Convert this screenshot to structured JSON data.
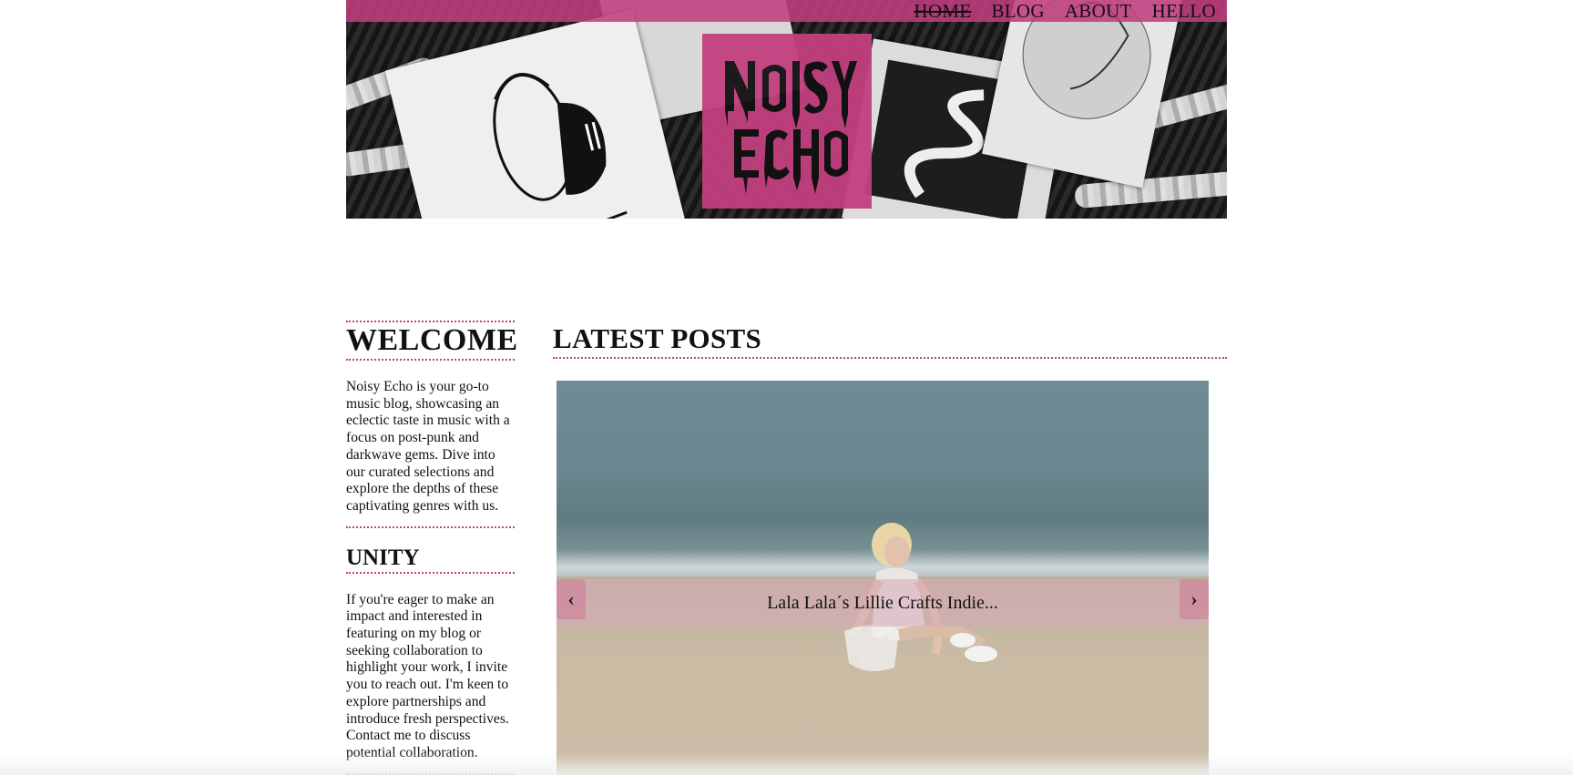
{
  "nav": {
    "items": [
      {
        "label": "HOME",
        "active": true
      },
      {
        "label": "BLOG",
        "active": false
      },
      {
        "label": "ABOUT",
        "active": false
      },
      {
        "label": "HELLO",
        "active": false
      }
    ]
  },
  "brand": {
    "logo_text": "NOISY ECHO",
    "accent_color": "#c2407f"
  },
  "sidebar": {
    "welcome": {
      "title": "WELCOME",
      "text": "Noisy Echo is your go-to music blog, showcasing an eclectic taste in music with a focus on post-punk and darkwave gems. Dive into our curated selections and explore the depths of these captivating genres with us."
    },
    "unity": {
      "title": "UNITY",
      "text": "If you're eager to make an impact and interested in featuring on my blog or seeking collaboration to highlight your work, I invite you to reach out. I'm keen to explore partnerships and introduce fresh perspectives. Contact me to discuss potential collaboration."
    }
  },
  "main": {
    "title": "LATEST POSTS",
    "carousel": {
      "caption": "Lala Lala´s Lillie Crafts Indie...",
      "prev": "‹",
      "next": "›"
    }
  }
}
